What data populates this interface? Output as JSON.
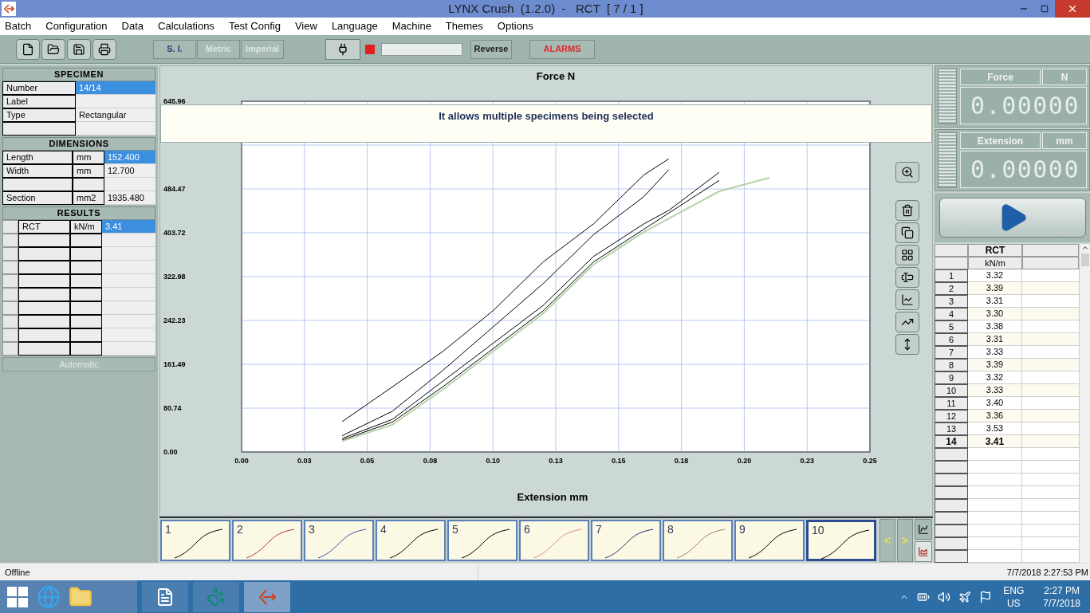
{
  "window": {
    "title": "LYNX Crush  (1.2.0)  -   RCT  [ 7 / 1 ]"
  },
  "menu": [
    "Batch",
    "Configuration",
    "Data",
    "Calculations",
    "Test Config",
    "View",
    "Language",
    "Machine",
    "Themes",
    "Options"
  ],
  "toolbar": {
    "units": [
      {
        "label": "S. I.",
        "disabled": false
      },
      {
        "label": "Metric",
        "disabled": true
      },
      {
        "label": "Imperial",
        "disabled": true
      }
    ],
    "buttons": [
      {
        "label": "Reverse",
        "kind": "plain"
      },
      {
        "label": "ALARMS",
        "kind": "alarm"
      }
    ]
  },
  "specimen": {
    "heading": "SPECIMEN",
    "rows": [
      {
        "label": "Number",
        "value": "14/14",
        "selected": true
      },
      {
        "label": "Label",
        "selected": false
      },
      {
        "label": "Type",
        "value": "Rectangular",
        "selected": false
      },
      {
        "selected": false
      }
    ]
  },
  "dimensions": {
    "heading": "DIMENSIONS",
    "rows": [
      {
        "label": "Length",
        "unit": "mm",
        "value": "152.400",
        "selected": true
      },
      {
        "label": "Width",
        "unit": "mm",
        "value": "12.700",
        "selected": false
      },
      {
        "selected": false
      },
      {
        "label": "Section",
        "unit": "mm2",
        "value": "1935.480",
        "selected": false
      }
    ]
  },
  "results": {
    "heading": "RESULTS",
    "rows": [
      {
        "label": "RCT",
        "unit": "kN/m",
        "value": "3.41",
        "selected": true
      },
      {
        "selected": false
      },
      {
        "selected": false
      },
      {
        "selected": false
      },
      {
        "selected": false
      },
      {
        "selected": false
      },
      {
        "selected": false
      },
      {
        "selected": false
      },
      {
        "selected": false
      },
      {
        "selected": false
      }
    ]
  },
  "automatic_button": {
    "label": "Automatic",
    "disabled": true
  },
  "chart": {
    "tooltip": "It allows multiple specimens being selected",
    "chart_data": {
      "type": "line",
      "grid": true,
      "title": "Force  N",
      "xlabel": "Extension  mm",
      "x": [
        0.04,
        0.06,
        0.08,
        0.1,
        0.12,
        0.14,
        0.16,
        0.17,
        0.19,
        0.21
      ],
      "series": [
        {
          "color": "#000000",
          "values": [
            56,
            120,
            185,
            260,
            350,
            420,
            510,
            540,
            null,
            null
          ]
        },
        {
          "color": "#000000",
          "values": [
            30,
            75,
            150,
            230,
            310,
            400,
            470,
            520,
            null,
            null
          ]
        },
        {
          "color": "#000000",
          "values": [
            25,
            60,
            130,
            200,
            270,
            360,
            420,
            445,
            515,
            null
          ]
        },
        {
          "color": "#000000",
          "values": [
            22,
            55,
            120,
            190,
            260,
            350,
            410,
            440,
            500,
            null
          ]
        },
        {
          "color": "#b5d3a8",
          "values": [
            20,
            50,
            115,
            185,
            255,
            345,
            405,
            430,
            480,
            505
          ]
        }
      ],
      "xlim": [
        0,
        0.25
      ],
      "ylim": [
        0,
        645.96
      ],
      "xticks": [
        {
          "value": 0,
          "label": "0.00"
        },
        {
          "value": 0.025,
          "label": "0.03"
        },
        {
          "value": 0.05,
          "label": "0.05"
        },
        {
          "value": 0.075,
          "label": "0.08"
        },
        {
          "value": 0.1,
          "label": "0.10"
        },
        {
          "value": 0.125,
          "label": "0.13"
        },
        {
          "value": 0.15,
          "label": "0.15"
        },
        {
          "value": 0.175,
          "label": "0.18"
        },
        {
          "value": 0.2,
          "label": "0.20"
        },
        {
          "value": 0.225,
          "label": "0.23"
        },
        {
          "value": 0.25,
          "label": "0.25"
        }
      ],
      "yticks": [
        {
          "value": 0,
          "label": "0.00"
        },
        {
          "value": 80.74,
          "label": "80.74"
        },
        {
          "value": 161.49,
          "label": "161.49"
        },
        {
          "value": 242.23,
          "label": "242.23"
        },
        {
          "value": 322.98,
          "label": "322.98"
        },
        {
          "value": 403.72,
          "label": "403.72"
        },
        {
          "value": 484.47,
          "label": "484.47"
        },
        {
          "value": 645.96,
          "label": "645.96"
        }
      ]
    }
  },
  "thumbnails": [
    {
      "label": "1",
      "color": "#000000",
      "selected": false
    },
    {
      "label": "2",
      "color": "#b03a3a",
      "selected": false
    },
    {
      "label": "3",
      "color": "#4a4aa0",
      "selected": false
    },
    {
      "label": "4",
      "color": "#000000",
      "selected": false
    },
    {
      "label": "5",
      "color": "#000000",
      "selected": false
    },
    {
      "label": "6",
      "color": "#e08a8a",
      "selected": false
    },
    {
      "label": "7",
      "color": "#2c2c70",
      "selected": false
    },
    {
      "label": "8",
      "color": "#a08060",
      "selected": false
    },
    {
      "label": "9",
      "color": "#000000",
      "selected": false
    },
    {
      "label": "10",
      "color": "#000000",
      "selected": true
    }
  ],
  "thumbnail_nav": {
    "previous": "<",
    "next": ">"
  },
  "readouts": [
    {
      "label": "Force",
      "unit": "N",
      "value": "0.00000"
    },
    {
      "label": "Extension",
      "unit": "mm",
      "value": "0.00000"
    }
  ],
  "results_table": {
    "column": {
      "heading": "RCT",
      "unit": "kN/m"
    },
    "rows": [
      {
        "index": "1",
        "value": "3.32",
        "selected": false
      },
      {
        "index": "2",
        "value": "3.39",
        "selected": false
      },
      {
        "index": "3",
        "value": "3.31",
        "selected": false
      },
      {
        "index": "4",
        "value": "3.30",
        "selected": false
      },
      {
        "index": "5",
        "value": "3.38",
        "selected": false
      },
      {
        "index": "6",
        "value": "3.31",
        "selected": false
      },
      {
        "index": "7",
        "value": "3.33",
        "selected": false
      },
      {
        "index": "8",
        "value": "3.39",
        "selected": false
      },
      {
        "index": "9",
        "value": "3.32",
        "selected": false
      },
      {
        "index": "10",
        "value": "3.33",
        "selected": false
      },
      {
        "index": "11",
        "value": "3.40",
        "selected": false
      },
      {
        "index": "12",
        "value": "3.36",
        "selected": false
      },
      {
        "index": "13",
        "value": "3.53",
        "selected": false
      },
      {
        "index": "14",
        "value": "3.41",
        "selected": true
      }
    ]
  },
  "status_bar": {
    "state": "Offline",
    "timestamp": "7/7/2018 2:27:53 PM"
  },
  "taskbar": {
    "language": "ENG",
    "region": "US",
    "time": "2:27 PM",
    "date": "7/7/2018"
  }
}
